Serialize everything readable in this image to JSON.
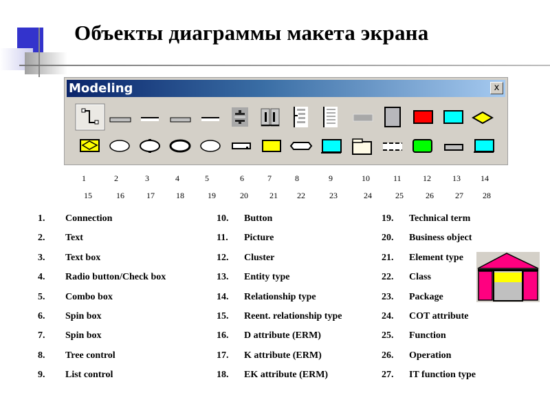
{
  "slide": {
    "title": "Объекты диаграммы макета экрана"
  },
  "window": {
    "title": "Modeling",
    "close_label": "x"
  },
  "toolbar": {
    "row1": [
      {
        "id": 1,
        "icon": "connection-icon"
      },
      {
        "id": 2,
        "icon": "text-icon"
      },
      {
        "id": 3,
        "icon": "text-box-icon"
      },
      {
        "id": 4,
        "icon": "radio-checkbox-icon"
      },
      {
        "id": 5,
        "icon": "combo-box-icon"
      },
      {
        "id": 6,
        "icon": "spin-box-vertical-icon"
      },
      {
        "id": 7,
        "icon": "spin-box-horizontal-icon"
      },
      {
        "id": 8,
        "icon": "tree-control-icon"
      },
      {
        "id": 9,
        "icon": "list-control-icon"
      },
      {
        "id": 10,
        "icon": "button-icon"
      },
      {
        "id": 11,
        "icon": "picture-icon"
      },
      {
        "id": 12,
        "icon": "cluster-icon"
      },
      {
        "id": 13,
        "icon": "entity-type-icon"
      },
      {
        "id": 14,
        "icon": "relationship-type-icon"
      }
    ],
    "row2": [
      {
        "id": 15,
        "icon": "reentrant-relationship-icon"
      },
      {
        "id": 16,
        "icon": "d-attribute-icon"
      },
      {
        "id": 17,
        "icon": "k-attribute-icon"
      },
      {
        "id": 18,
        "icon": "ek-attribute-icon"
      },
      {
        "id": 19,
        "icon": "technical-term-icon"
      },
      {
        "id": 20,
        "icon": "business-object-icon"
      },
      {
        "id": 21,
        "icon": "element-type-icon"
      },
      {
        "id": 22,
        "icon": "class-icon"
      },
      {
        "id": 23,
        "icon": "package-icon"
      },
      {
        "id": 24,
        "icon": "cot-attribute-icon"
      },
      {
        "id": 25,
        "icon": "function-icon"
      },
      {
        "id": 26,
        "icon": "operation-icon"
      },
      {
        "id": 27,
        "icon": "it-function-type-icon"
      },
      {
        "id": 28,
        "icon": "screen-icon"
      }
    ],
    "numbers_row1": [
      "1",
      "2",
      "3",
      "4",
      "5",
      "6",
      "7",
      "8",
      "9",
      "10",
      "11",
      "12",
      "13",
      "14"
    ],
    "numbers_row2": [
      "15",
      "16",
      "17",
      "18",
      "19",
      "20",
      "21",
      "22",
      "23",
      "24",
      "25",
      "26",
      "27",
      "28"
    ],
    "colors": {
      "red": "#ff0000",
      "cyan": "#00ffff",
      "yellow": "#ffff00",
      "green": "#00ff00",
      "cream": "#fffbe6",
      "gray": "#c0c0c0"
    }
  },
  "legend": {
    "col1": [
      {
        "n": "1.",
        "label": "Connection"
      },
      {
        "n": "2.",
        "label": "Text"
      },
      {
        "n": "3.",
        "label": "Text box"
      },
      {
        "n": "4.",
        "label": "Radio button/Check box"
      },
      {
        "n": "5.",
        "label": "Combo box"
      },
      {
        "n": "6.",
        "label": "Spin box"
      },
      {
        "n": "7.",
        "label": "Spin box"
      },
      {
        "n": "8.",
        "label": "Tree control"
      },
      {
        "n": "9.",
        "label": "List control"
      }
    ],
    "col2": [
      {
        "n": "10.",
        "label": "Button"
      },
      {
        "n": "11.",
        "label": "Picture"
      },
      {
        "n": "12.",
        "label": "Cluster"
      },
      {
        "n": "13.",
        "label": "Entity type"
      },
      {
        "n": "14.",
        "label": "Relationship type"
      },
      {
        "n": "15.",
        "label": "Reent. relationship type"
      },
      {
        "n": "16.",
        "label": "D attribute (ERM)"
      },
      {
        "n": "17.",
        "label": "K attribute (ERM)"
      },
      {
        "n": "18.",
        "label": "EK attribute (ERM)"
      }
    ],
    "col3": [
      {
        "n": "19.",
        "label": "Technical term"
      },
      {
        "n": "20.",
        "label": "Business object"
      },
      {
        "n": "21.",
        "label": "Element type"
      },
      {
        "n": "22.",
        "label": "Class"
      },
      {
        "n": "23.",
        "label": "Package"
      },
      {
        "n": "24.",
        "label": "COT attribute"
      },
      {
        "n": "25.",
        "label": "Function"
      },
      {
        "n": "26.",
        "label": "Operation"
      },
      {
        "n": "27.",
        "label": "IT function type"
      }
    ]
  },
  "side_image": {
    "icon": "house-icon"
  }
}
